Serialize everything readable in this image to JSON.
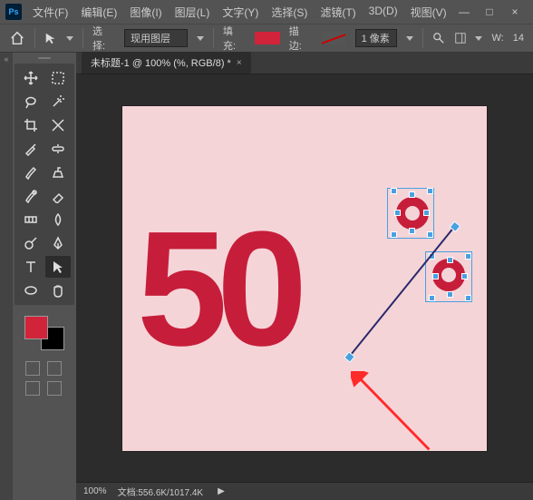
{
  "titlebar": {
    "app": "Ps",
    "menus": [
      "文件(F)",
      "编辑(E)",
      "图像(I)",
      "图层(L)",
      "文字(Y)",
      "选择(S)",
      "滤镜(T)",
      "3D(D)",
      "视图(V)"
    ],
    "win": {
      "min": "—",
      "max": "□",
      "close": "×"
    }
  },
  "options": {
    "select_label": "选择:",
    "select_value": "现用图层",
    "fill_label": "填充:",
    "stroke_label": "描边:",
    "stroke_size": "1 像素",
    "w_label": "W:",
    "w_value": "14"
  },
  "tool_label": "",
  "document": {
    "tab": "未标题-1 @ 100% (%, RGB/8) *",
    "canvas_text": "50"
  },
  "status": {
    "zoom": "100%",
    "doc": "文档:556.6K/1017.4K"
  },
  "colors": {
    "fill": "#d1233a"
  }
}
